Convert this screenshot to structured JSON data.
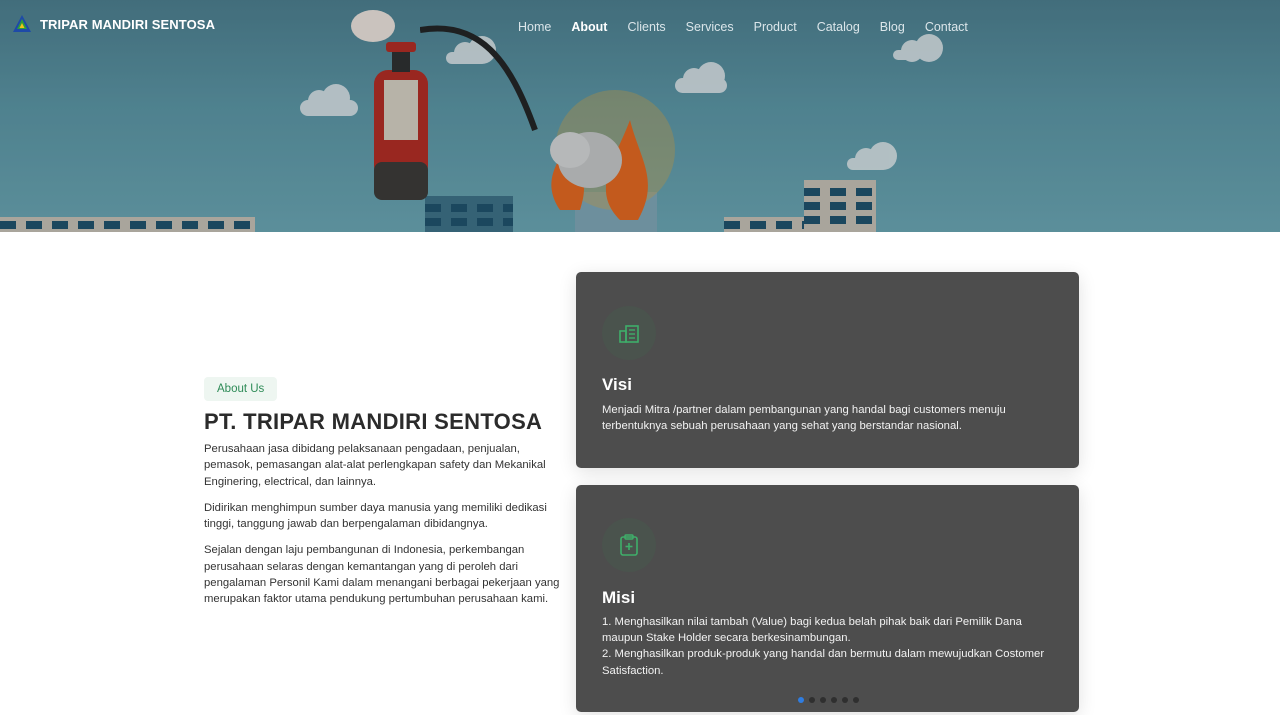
{
  "brand": {
    "name": "TRIPAR MANDIRI SENTOSA",
    "logo_icon": "triangle-logo-icon"
  },
  "nav": {
    "items": [
      {
        "label": "Home",
        "active": false
      },
      {
        "label": "About",
        "active": true
      },
      {
        "label": "Clients",
        "active": false
      },
      {
        "label": "Services",
        "active": false
      },
      {
        "label": "Product",
        "active": false
      },
      {
        "label": "Catalog",
        "active": false
      },
      {
        "label": "Blog",
        "active": false
      },
      {
        "label": "Contact",
        "active": false
      }
    ]
  },
  "about": {
    "badge": "About Us",
    "title": "PT. TRIPAR MANDIRI SENTOSA",
    "paragraphs": [
      "Perusahaan jasa dibidang pelaksanaan pengadaan, penjualan, pemasok, pemasangan alat-alat perlengkapan safety dan Mekanikal Enginering, electrical, dan lainnya.",
      "Didirikan menghimpun sumber daya manusia yang memiliki dedikasi tinggi, tanggung jawab dan berpengalaman dibidangnya.",
      "Sejalan dengan laju pembangunan di Indonesia, perkembangan perusahaan selaras dengan kemantangan yang di peroleh dari pengalaman Personil Kami dalam menangani berbagai pekerjaan yang merupakan faktor utama pendukung pertumbuhan perusahaan kami."
    ]
  },
  "visi": {
    "icon": "buildings-icon",
    "title": "Visi",
    "text": "Menjadi Mitra /partner dalam pembangunan yang handal bagi customers menuju terbentuknya sebuah perusahaan yang sehat yang berstandar nasional."
  },
  "misi": {
    "icon": "clipboard-icon",
    "title": "Misi",
    "lines": [
      "1. Menghasilkan nilai tambah (Value) bagi kedua belah pihak baik dari Pemilik Dana maupun Stake Holder secara berkesinambungan.",
      "2. Menghasilkan produk-produk yang handal dan bermutu dalam mewujudkan Costomer Satisfaction."
    ]
  },
  "carousel": {
    "count": 6,
    "active_index": 0
  },
  "colors": {
    "accent": "#2e8b57",
    "card_bg": "#4d4d4d",
    "dot_active": "#2f7de1"
  }
}
